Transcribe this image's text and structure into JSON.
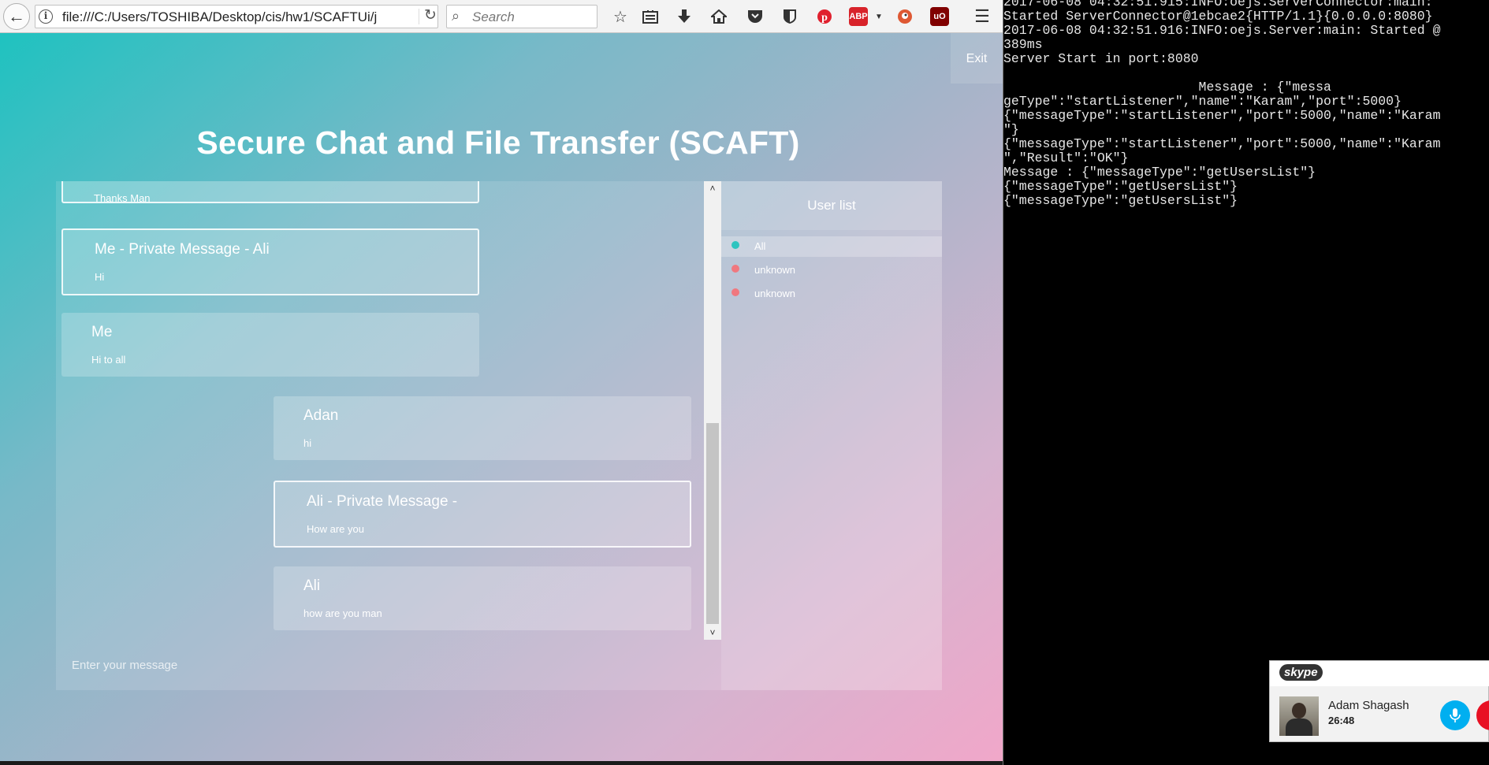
{
  "browser": {
    "url": "file:///C:/Users/TOSHIBA/Desktop/cis/hw1/SCAFTUi/j",
    "search_placeholder": "Search",
    "icons": [
      "back-arrow-icon",
      "info-icon",
      "reload-icon",
      "search-icon",
      "bookmark-star-icon",
      "reading-list-icon",
      "download-icon",
      "home-icon",
      "pocket-icon",
      "bitwarden-icon",
      "pinterest-icon",
      "adblock-plus-icon",
      "duckduckgo-icon",
      "ublock-origin-icon",
      "hamburger-menu-icon"
    ],
    "adblock_badge": "ABP",
    "ublock_badge": "uO"
  },
  "app": {
    "exit_label": "Exit",
    "title": "Secure Chat and File Transfer (SCAFT)",
    "messages": [
      {
        "sender": "",
        "body": "Thanks Man",
        "private": true,
        "side": "left"
      },
      {
        "sender": "Me - Private Message - Ali",
        "body": "Hi",
        "private": true,
        "side": "left"
      },
      {
        "sender": "Me",
        "body": "Hi to all",
        "private": false,
        "side": "left"
      },
      {
        "sender": "Adan",
        "body": "hi",
        "private": false,
        "side": "right"
      },
      {
        "sender": "Ali - Private Message -",
        "body": "How are you",
        "private": true,
        "side": "right"
      },
      {
        "sender": "Ali",
        "body": "how are you man",
        "private": false,
        "side": "right"
      }
    ],
    "user_list_title": "User list",
    "users": [
      {
        "name": "All",
        "status_color": "#2ec4bf",
        "active": true
      },
      {
        "name": "unknown",
        "status_color": "#f0787f",
        "active": false
      },
      {
        "name": "unknown",
        "status_color": "#f0787f",
        "active": false
      }
    ],
    "input_placeholder": "Enter your message"
  },
  "console": {
    "lines": [
      "2017-06-08 04:32:51.915:INFO:oejs.ServerConnector:main:",
      "Started ServerConnector@1ebcae2{HTTP/1.1}{0.0.0.0:8080}",
      "2017-06-08 04:32:51.916:INFO:oejs.Server:main: Started @",
      "389ms",
      "Server Start in port:8080",
      "",
      "                         Message : {\"messa",
      "geType\":\"startListener\",\"name\":\"Karam\",\"port\":5000}",
      "{\"messageType\":\"startListener\",\"port\":5000,\"name\":\"Karam",
      "\"}",
      "{\"messageType\":\"startListener\",\"port\":5000,\"name\":\"Karam",
      "\",\"Result\":\"OK\"}",
      "Message : {\"messageType\":\"getUsersList\"}",
      "{\"messageType\":\"getUsersList\"}",
      "{\"messageType\":\"getUsersList\"}"
    ]
  },
  "skype": {
    "logo": "skype",
    "caller_name": "Adam Shagash",
    "call_duration": "26:48"
  }
}
